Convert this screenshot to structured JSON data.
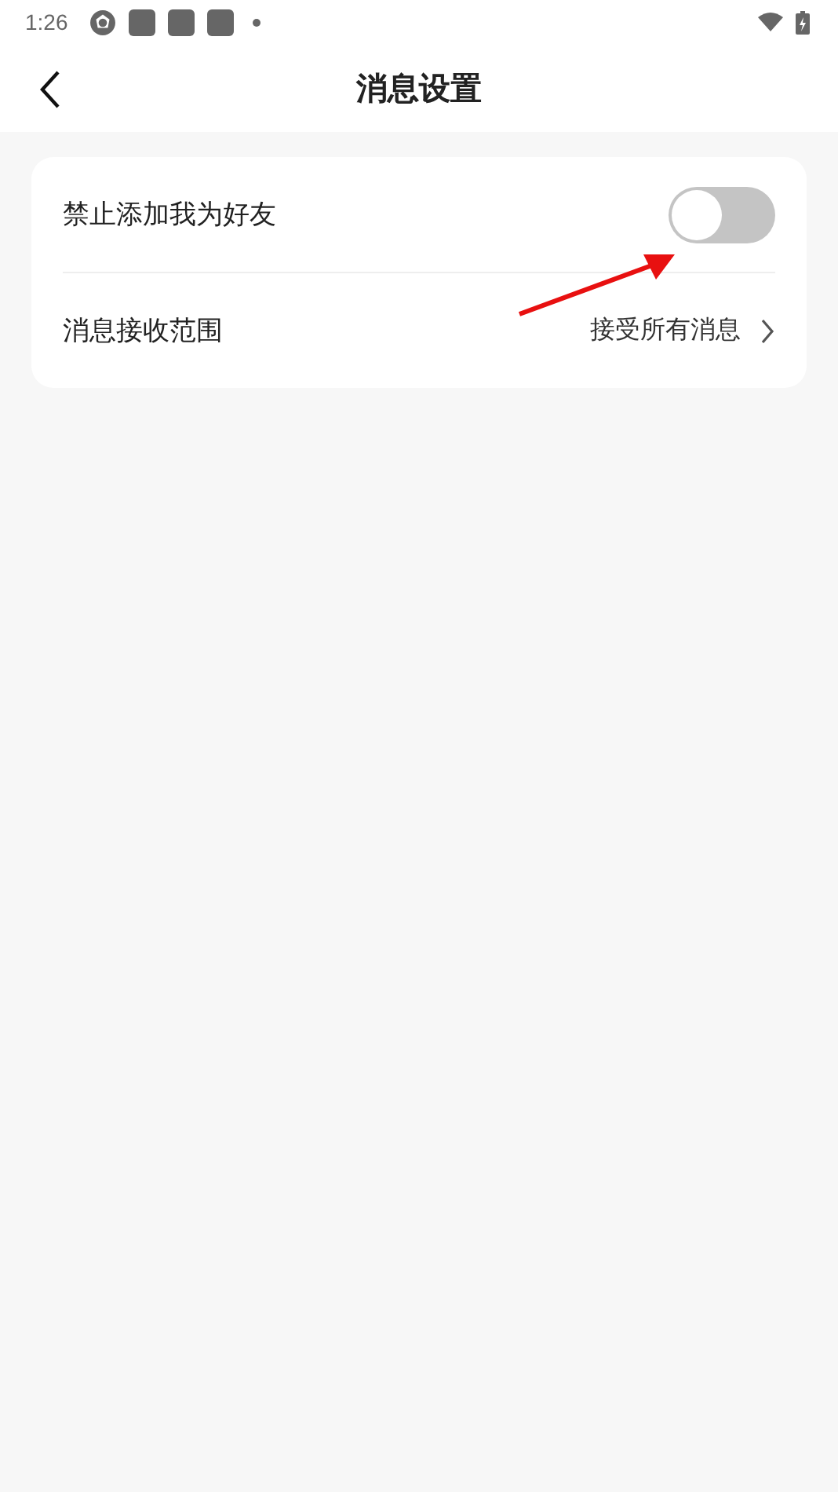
{
  "status_bar": {
    "time": "1:26"
  },
  "header": {
    "title": "消息设置"
  },
  "settings": [
    {
      "kind": "toggle",
      "label": "禁止添加我为好友",
      "on": false
    },
    {
      "kind": "link",
      "label": "消息接收范围",
      "value": "接受所有消息"
    }
  ]
}
